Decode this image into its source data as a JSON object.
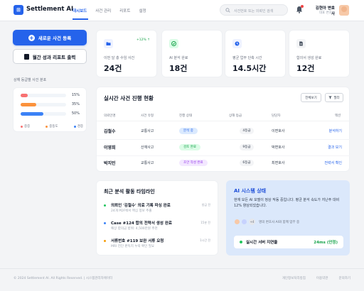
{
  "app": {
    "title": "Settlement AI",
    "logo_char": "⊞"
  },
  "nav": {
    "items": [
      "대시보드",
      "사건 관리",
      "리포트",
      "설정"
    ]
  },
  "search": {
    "placeholder": "사건번호 또는 의뢰인 검색"
  },
  "user": {
    "name": "김현아 변호사",
    "role": "대표 변호사"
  },
  "sidebar": {
    "primary_button": "새로운 사건 등록",
    "secondary_button": "월간 성과 리포트 출력",
    "section_title": "상해 등급별 사건 분포",
    "bars": [
      {
        "percent": 15,
        "label": "15%",
        "color": "#f87171"
      },
      {
        "percent": 35,
        "label": "35%",
        "color": "#fb923c"
      },
      {
        "percent": 50,
        "label": "50%",
        "color": "#3b82f6"
      }
    ],
    "legend": [
      {
        "label": "중증",
        "color": "#f87171"
      },
      {
        "label": "중등도",
        "color": "#fb923c"
      },
      {
        "label": "경증",
        "color": "#3b82f6"
      }
    ]
  },
  "stats": [
    {
      "label": "이번 달 총 수임 사건",
      "value": "24건",
      "badge": "+12% ↑",
      "icon": "folder-icon"
    },
    {
      "label": "AI 분석 완료",
      "value": "18건",
      "badge": "",
      "icon": "check-circle-icon"
    },
    {
      "label": "평균 업무 단축 시간",
      "value": "14.5시간",
      "badge": "",
      "icon": "clock-icon"
    },
    {
      "label": "합의서 생성 완료",
      "value": "12건",
      "badge": "",
      "icon": "document-icon"
    }
  ],
  "table": {
    "title": "실시간 사건 진행 현황",
    "view_all": "전체보기",
    "filter": "필터",
    "headers": [
      "의뢰인명",
      "사건 유형",
      "진행 상태",
      "상해 등급",
      "담당자",
      "액션"
    ],
    "rows": [
      {
        "name": "김철수",
        "type": "교통사고",
        "status": "분석 중",
        "status_color": "#dbeafe",
        "status_text_color": "#2563eb",
        "grade": "4등급",
        "owner": "이변호사",
        "action": "분석하기"
      },
      {
        "name": "이영희",
        "type": "산재사고",
        "status": "검토 완료",
        "status_color": "#dcfce7",
        "status_text_color": "#16a34a",
        "grade": "9등급",
        "owner": "박변호사",
        "action": "결과 보기"
      },
      {
        "name": "박지민",
        "type": "교통사고",
        "status": "초안 작성 완료",
        "status_color": "#f3e8ff",
        "status_text_color": "#9333ea",
        "grade": "6등급",
        "owner": "최변호사",
        "action": "전략서 확인"
      }
    ]
  },
  "timeline": {
    "title": "최근 분석 활동 타임라인",
    "items": [
      {
        "head": "의뢰인 '김철수' 의료 기록 파싱 완료",
        "sub": "24개 PDF에서 핵심 정보 추출",
        "time": "방금 전",
        "color": "#22c55e"
      },
      {
        "head": "Case #124 합의 전략서 생성 완료",
        "sub": "예상 합의금 범위: 4,500만원 추천",
        "time": "15분 전",
        "color": "#3b82f6"
      },
      {
        "head": "서류번호 #119 보완 서류 요청",
        "sub": "MRI 진단 판독지 누락 확인 필요",
        "time": "1시간 전",
        "color": "#f59e0b"
      }
    ]
  },
  "ai_status": {
    "title": "AI 시스템 상태",
    "description": "현재 모든 AI 모델이 정상 작동 중입니다. 평균 분석 속도가 지난주 대비 12% 향상되었습니다.",
    "more": "+4",
    "note": "명의 변호사 AI와 함께 업무 중",
    "latency_label": "실시간 서버 지연율",
    "latency_value": "24ms (안정)"
  },
  "footer": {
    "copyright": "© 2024 Settlement AI. All Rights Reserved. | 시스템관리자에이터",
    "links": [
      "개인정보처리방침",
      "이용약관",
      "문의하기"
    ]
  }
}
